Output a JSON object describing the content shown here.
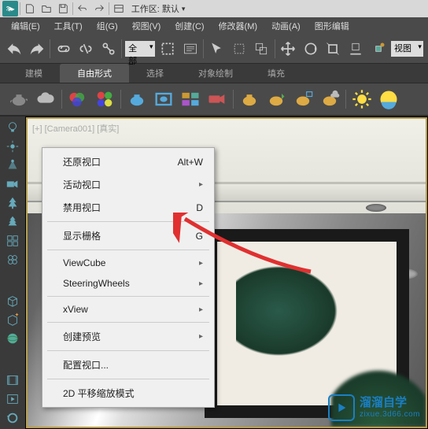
{
  "titlebar": {
    "app": "MAX",
    "workspace_label": "工作区: 默认"
  },
  "menus": [
    "编辑(E)",
    "工具(T)",
    "组(G)",
    "视图(V)",
    "创建(C)",
    "修改器(M)",
    "动画(A)",
    "图形编辑"
  ],
  "toolbar1": {
    "dropdown": "全部",
    "viewport_label": "视图"
  },
  "tabs": [
    "建模",
    "自由形式",
    "选择",
    "对象绘制",
    "填充"
  ],
  "active_tab": 1,
  "viewport_label": "[+] [Camera001] [真实]",
  "context_menu": {
    "items": [
      {
        "label": "还原视口",
        "key": "Alt+W"
      },
      {
        "label": "活动视口",
        "sub": true
      },
      {
        "label": "禁用视口",
        "key": "D"
      },
      {
        "sep": true
      },
      {
        "label": "显示栅格",
        "key": "G"
      },
      {
        "sep": true
      },
      {
        "label": "ViewCube",
        "sub": true
      },
      {
        "label": "SteeringWheels",
        "sub": true
      },
      {
        "sep": true
      },
      {
        "label": "xView",
        "sub": true
      },
      {
        "sep": true
      },
      {
        "label": "创建预览",
        "sub": true
      },
      {
        "sep": true
      },
      {
        "label": "配置视口...",
        "highlight": true
      },
      {
        "sep": true
      },
      {
        "label": "2D 平移缩放模式"
      }
    ]
  },
  "watermark": {
    "brand": "溜溜自学",
    "url": "zixue.3d66.com"
  }
}
